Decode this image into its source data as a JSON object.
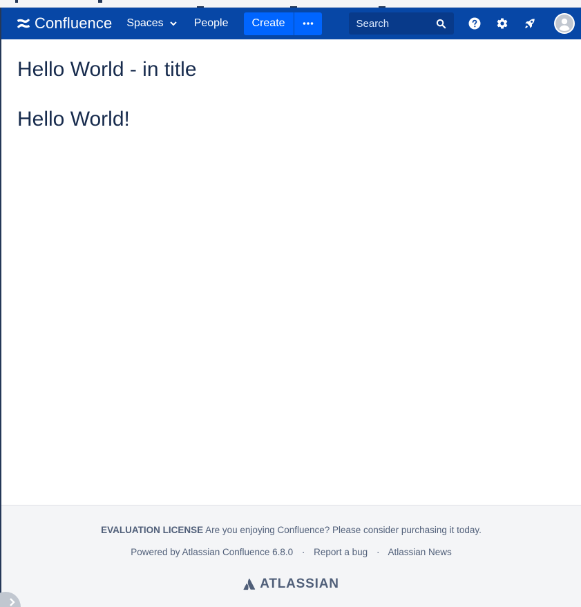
{
  "header": {
    "logo_text": "Confluence",
    "spaces_label": "Spaces",
    "people_label": "People",
    "create_label": "Create",
    "search_placeholder": "Search"
  },
  "page": {
    "title": "Hello World - in title",
    "body_heading": "Hello World!"
  },
  "footer": {
    "license_strong": "EVALUATION LICENSE",
    "license_text": "Are you enjoying Confluence? Please consider purchasing it today.",
    "powered_by": "Powered by Atlassian Confluence 6.8.0",
    "separator": "·",
    "report_bug": "Report a bug",
    "news": "Atlassian News",
    "brand": "ATLASSIAN"
  },
  "colors": {
    "header_bg": "#0747a6",
    "create_bg": "#0065ff",
    "search_bg": "#083a8a",
    "footer_bg": "#f4f5f7",
    "text": "#172b4d"
  },
  "icons": [
    "confluence-logo-icon",
    "chevron-down-icon",
    "more-dots-icon",
    "search-icon",
    "help-icon",
    "gear-icon",
    "rocket-icon",
    "avatar-icon",
    "chevron-right-icon",
    "atlassian-logo-icon"
  ]
}
